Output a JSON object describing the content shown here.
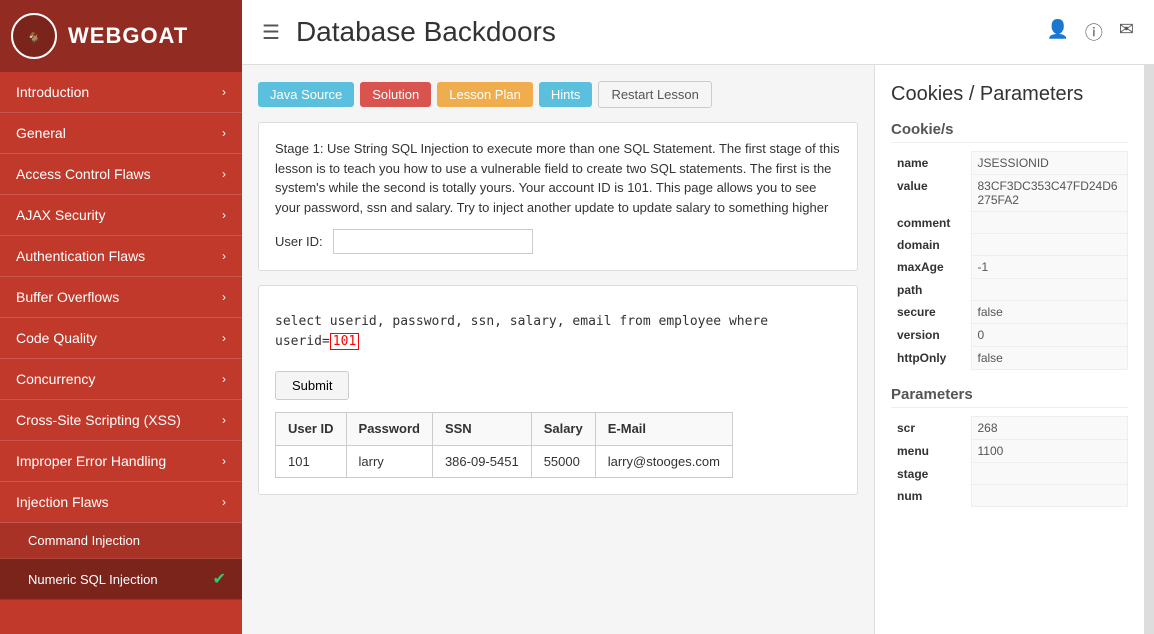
{
  "sidebar": {
    "title": "WEBGOAT",
    "items": [
      {
        "label": "Introduction",
        "expanded": false
      },
      {
        "label": "General",
        "expanded": false
      },
      {
        "label": "Access Control Flaws",
        "expanded": false
      },
      {
        "label": "AJAX Security",
        "expanded": false
      },
      {
        "label": "Authentication Flaws",
        "expanded": false
      },
      {
        "label": "Buffer Overflows",
        "expanded": false
      },
      {
        "label": "Code Quality",
        "expanded": false
      },
      {
        "label": "Concurrency",
        "expanded": false
      },
      {
        "label": "Cross-Site Scripting (XSS)",
        "expanded": false
      },
      {
        "label": "Improper Error Handling",
        "expanded": false
      },
      {
        "label": "Injection Flaws",
        "expanded": true,
        "subItems": [
          {
            "label": "Command Injection",
            "active": false
          },
          {
            "label": "Numeric SQL Injection",
            "active": true,
            "check": true
          }
        ]
      }
    ]
  },
  "header": {
    "title": "Database Backdoors",
    "menu_toggle": "☰"
  },
  "toolbar": {
    "java_source": "Java Source",
    "solution": "Solution",
    "lesson_plan": "Lesson Plan",
    "hints": "Hints",
    "restart": "Restart Lesson"
  },
  "lesson": {
    "description": "Stage 1: Use String SQL Injection to execute more than one SQL Statement. The first stage of this lesson is to teach you how to use a vulnerable field to create two SQL statements. The first is the system's while the second is totally yours. Your account ID is 101. This page allows you to see your password, ssn and salary. Try to inject another update to update salary to something higher",
    "form_label": "User ID:",
    "form_placeholder": "",
    "sql_prefix": "select userid, password, ssn, salary, email from employee where userid=",
    "sql_highlight": "101",
    "table": {
      "headers": [
        "User ID",
        "Password",
        "SSN",
        "Salary",
        "E-Mail"
      ],
      "rows": [
        [
          "101",
          "larry",
          "386-09-5451",
          "55000",
          "larry@stooges.com"
        ]
      ]
    },
    "submit_label": "Submit"
  },
  "right_panel": {
    "title": "Cookies / Parameters",
    "cookies_title": "Cookie/s",
    "cookies": [
      {
        "key": "name",
        "value": "JSESSIONID"
      },
      {
        "key": "value",
        "value": "83CF3DC353C47FD24D6275FA2"
      },
      {
        "key": "comment",
        "value": ""
      },
      {
        "key": "domain",
        "value": ""
      },
      {
        "key": "maxAge",
        "value": "-1"
      },
      {
        "key": "path",
        "value": ""
      },
      {
        "key": "secure",
        "value": "false"
      },
      {
        "key": "version",
        "value": "0"
      },
      {
        "key": "httpOnly",
        "value": "false"
      }
    ],
    "params_title": "Parameters",
    "params": [
      {
        "key": "scr",
        "value": "268"
      },
      {
        "key": "menu",
        "value": "1100"
      },
      {
        "key": "stage",
        "value": ""
      },
      {
        "key": "num",
        "value": ""
      }
    ]
  }
}
